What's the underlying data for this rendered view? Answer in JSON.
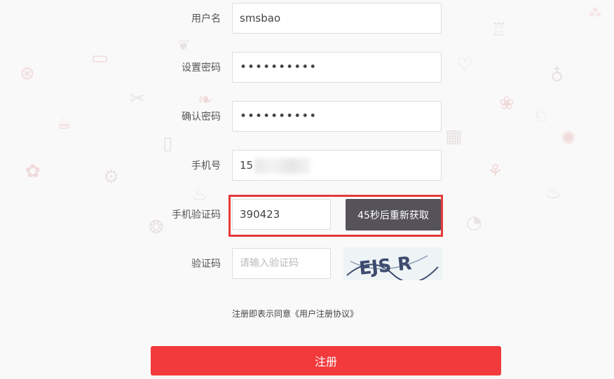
{
  "form": {
    "username": {
      "label": "用户名",
      "value": "smsbao"
    },
    "password": {
      "label": "设置密码",
      "value": "••••••••••"
    },
    "confirm_password": {
      "label": "确认密码",
      "value": "••••••••••"
    },
    "phone": {
      "label": "手机号",
      "value_visible": "15"
    },
    "sms_code": {
      "label": "手机验证码",
      "value": "390423",
      "button_label": "45秒后重新获取"
    },
    "captcha": {
      "label": "验证码",
      "placeholder": "请输入验证码",
      "image_text": "EJS R"
    },
    "agreement": {
      "prefix": "注册即表示同意",
      "link": "《用户注册协议》"
    },
    "submit_label": "注册"
  },
  "colors": {
    "accent_red": "#f23a3c",
    "highlight_red": "#e43a3a",
    "sms_button": "#55525a"
  },
  "icons": [
    "food-doodle-icons"
  ]
}
